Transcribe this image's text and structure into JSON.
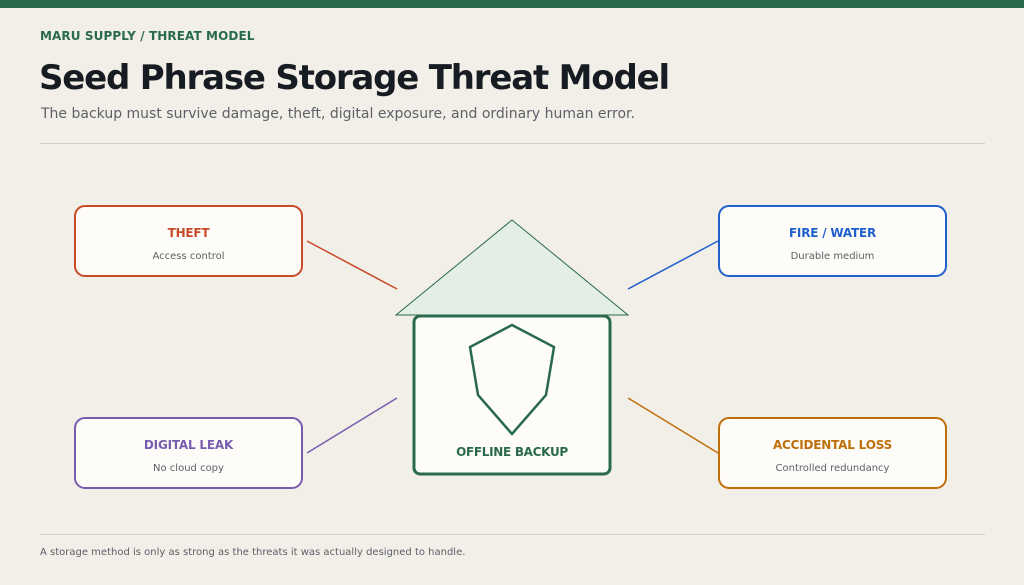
{
  "header": {
    "eyebrow": "MARU SUPPLY / THREAT MODEL",
    "title": "Seed Phrase Storage Threat Model",
    "subtitle": "The backup must survive damage, theft, digital exposure, and ordinary human error."
  },
  "threats": [
    {
      "title": "THEFT",
      "control": "Access control",
      "color": "#c84a28"
    },
    {
      "title": "FIRE / WATER",
      "control": "Durable medium",
      "color": "#2060cc"
    },
    {
      "title": "DIGITAL LEAK",
      "control": "No cloud copy",
      "color": "#7a5cae"
    },
    {
      "title": "ACCIDENTAL LOSS",
      "control": "Controlled redundancy",
      "color": "#bf6f0a"
    }
  ],
  "core": {
    "label": "OFFLINE BACKUP",
    "color": "#2a6a4a",
    "roof_fill": "#e3efe6",
    "icon": "shield-icon"
  },
  "footer": {
    "note": "A storage method is only as strong as the threats it was actually designed to handle."
  }
}
